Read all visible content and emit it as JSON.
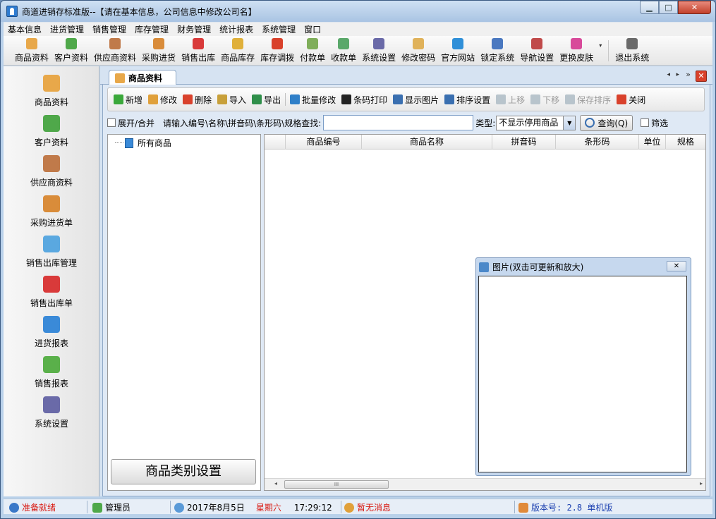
{
  "window": {
    "title": "商道进销存标准版--【请在基本信息，公司信息中修改公司名】",
    "min": "▁",
    "max": "□",
    "close": "✕"
  },
  "menu": [
    "基本信息",
    "进货管理",
    "销售管理",
    "库存管理",
    "财务管理",
    "统计报表",
    "系统管理",
    "窗口"
  ],
  "toolbar": [
    {
      "label": "商品资料",
      "icon": "boxes-icon",
      "color": "#e8a84a"
    },
    {
      "label": "客户资料",
      "icon": "customers-icon",
      "color": "#4fa84a"
    },
    {
      "label": "供应商资料",
      "icon": "suppliers-icon",
      "color": "#c07a4a"
    },
    {
      "label": "采购进货",
      "icon": "truck-icon",
      "color": "#d98c3a"
    },
    {
      "label": "销售出库",
      "icon": "basket-icon",
      "color": "#d93a3a"
    },
    {
      "label": "商品库存",
      "icon": "stock-icon",
      "color": "#e0b03a"
    },
    {
      "label": "库存调拨",
      "icon": "transfer-icon",
      "color": "#d9412b"
    },
    {
      "label": "付款单",
      "icon": "payment-icon",
      "color": "#7fae5a"
    },
    {
      "label": "收款单",
      "icon": "receipt-icon",
      "color": "#5aa86a"
    },
    {
      "label": "系统设置",
      "icon": "settings-icon",
      "color": "#6a6aa8"
    },
    {
      "label": "修改密码",
      "icon": "pencil-icon",
      "color": "#e0b25a"
    },
    {
      "label": "官方网站",
      "icon": "globe-icon",
      "color": "#2f8fd8"
    },
    {
      "label": "锁定系统",
      "icon": "monitor-lock-icon",
      "color": "#4a78c0"
    },
    {
      "label": "导航设置",
      "icon": "nav-icon",
      "color": "#c04a4a"
    },
    {
      "label": "更换皮肤",
      "icon": "palette-icon",
      "color": "#d84a9a"
    },
    {
      "label": "退出系统",
      "icon": "exit-icon",
      "color": "#6a6a6a"
    }
  ],
  "toolbar_more": "▾",
  "sidebar": [
    {
      "label": "商品资料",
      "icon": "boxes-icon",
      "color": "#e8a84a"
    },
    {
      "label": "客户资料",
      "icon": "customers-icon",
      "color": "#4fa84a"
    },
    {
      "label": "供应商资料",
      "icon": "suppliers-icon",
      "color": "#c07a4a"
    },
    {
      "label": "采购进货单",
      "icon": "truck-icon",
      "color": "#d98c3a"
    },
    {
      "label": "销售出库管理",
      "icon": "document-icon",
      "color": "#5aa8e0"
    },
    {
      "label": "销售出库单",
      "icon": "basket-icon",
      "color": "#d93a3a"
    },
    {
      "label": "进货报表",
      "icon": "pie-chart-icon",
      "color": "#3a8ad8"
    },
    {
      "label": "销售报表",
      "icon": "bar-chart-icon",
      "color": "#5ab04a"
    },
    {
      "label": "系统设置",
      "icon": "settings-icon",
      "color": "#6a6aa8"
    }
  ],
  "tab": {
    "label": "商品资料",
    "prev": "◂",
    "next": "▸",
    "menu": "»",
    "close": "✕"
  },
  "actions": [
    {
      "label": "新增",
      "icon": "add-icon",
      "color": "#3aa83a",
      "enabled": true
    },
    {
      "label": "修改",
      "icon": "edit-icon",
      "color": "#e0a03a",
      "enabled": true
    },
    {
      "label": "删除",
      "icon": "delete-icon",
      "color": "#d9412b",
      "enabled": true
    },
    {
      "label": "导入",
      "icon": "import-icon",
      "color": "#c8a03a",
      "enabled": true
    },
    {
      "label": "导出",
      "icon": "excel-export-icon",
      "color": "#2f8f4a",
      "enabled": true
    },
    {
      "label": "批量修改",
      "icon": "recycle-icon",
      "color": "#2f7fc8",
      "enabled": true
    },
    {
      "label": "条码打印",
      "icon": "barcode-icon",
      "color": "#222222",
      "enabled": true
    },
    {
      "label": "显示图片",
      "icon": "grid-image-icon",
      "color": "#3a6fb0",
      "enabled": true
    },
    {
      "label": "排序设置",
      "icon": "sort-icon",
      "color": "#3a6fb0",
      "enabled": true
    },
    {
      "label": "上移",
      "icon": "move-up-icon",
      "color": "#b8c4cc",
      "enabled": false
    },
    {
      "label": "下移",
      "icon": "move-down-icon",
      "color": "#b8c4cc",
      "enabled": false
    },
    {
      "label": "保存排序",
      "icon": "save-icon",
      "color": "#b8c4cc",
      "enabled": false
    },
    {
      "label": "关闭",
      "icon": "close-icon",
      "color": "#d9412b",
      "enabled": true
    }
  ],
  "search": {
    "expand_label": "展开/合并",
    "prompt": "请输入编号\\名称\\拼音码\\条形码\\规格查找:",
    "value": "",
    "type_label": "类型:",
    "type_value": "不显示停用商品",
    "query_label": "查询(Q)",
    "filter_label": "筛选"
  },
  "tree": {
    "root": "所有商品"
  },
  "category_button": "商品类别设置",
  "columns": [
    "",
    "商品编号",
    "商品名称",
    "拼音码",
    "条形码",
    "单位",
    "规格"
  ],
  "scroll": {
    "left": "◂",
    "right": "▸",
    "thumb": "III"
  },
  "picture": {
    "title": "图片(双击可更新和放大)",
    "close": "✕"
  },
  "status": {
    "ready": "准备就绪",
    "user": "管理员",
    "date": "2017年8月5日",
    "weekday": "星期六",
    "time": "17:29:12",
    "message": "暂无消息",
    "version": "版本号: 2.8 单机版",
    "ready_color": "#d9160e",
    "weekday_color": "#d9160e",
    "message_color": "#d9160e",
    "version_color": "#1a3fb0"
  }
}
